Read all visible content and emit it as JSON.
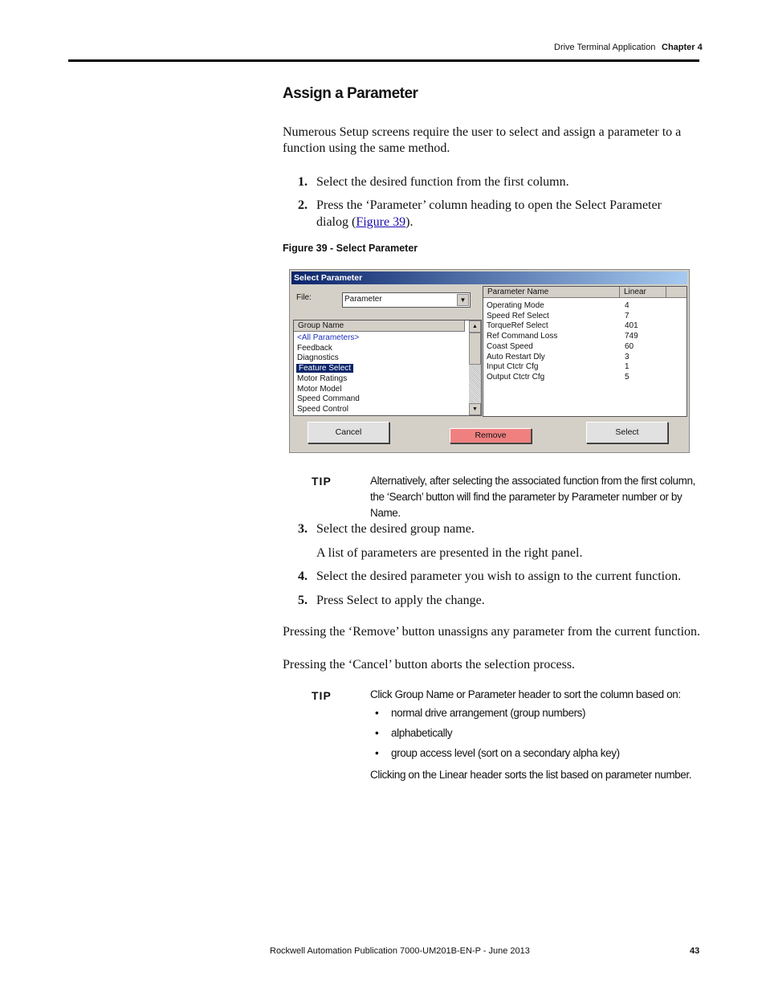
{
  "header": {
    "section": "Drive Terminal Application",
    "chapter": "Chapter 4"
  },
  "heading": "Assign a Parameter",
  "intro": "Numerous Setup screens require the user to select and assign a parameter to a function using the same method.",
  "steps": [
    {
      "num": "1.",
      "text": "Select the desired function from the first column."
    },
    {
      "num": "2.",
      "text_before": "Press the ‘Parameter’ column heading to open the Select Parameter dialog (",
      "link": "Figure 39",
      "text_after": ")."
    },
    {
      "num": "3.",
      "text": "Select the desired group name."
    },
    {
      "num": "4.",
      "text": "Select the desired parameter you wish to assign to the current function."
    },
    {
      "num": "5.",
      "text": "Press Select to apply the change."
    }
  ],
  "step3_note": "A list of parameters are presented in the right panel.",
  "figure_caption": "Figure 39 - Select Parameter",
  "dialog": {
    "title": "Select Parameter",
    "file_label": "File:",
    "file_value": "Parameter",
    "group_header": "Group Name",
    "groups": [
      "<All Parameters>",
      "Feedback",
      "Diagnostics",
      "Feature Select",
      "Motor Ratings",
      "Motor Model",
      "Speed Command",
      "Speed Control"
    ],
    "selected_group": "Feature Select",
    "param_header": "Parameter Name",
    "linear_header": "Linear",
    "params": [
      {
        "name": "Operating Mode",
        "linear": "4"
      },
      {
        "name": "Speed Ref Select",
        "linear": "7"
      },
      {
        "name": "TorqueRef Select",
        "linear": "401"
      },
      {
        "name": "Ref Command Loss",
        "linear": "749"
      },
      {
        "name": "Coast Speed",
        "linear": "60"
      },
      {
        "name": "Auto Restart Dly",
        "linear": "3"
      },
      {
        "name": "Input Ctctr Cfg",
        "linear": "1"
      },
      {
        "name": "Output Ctctr Cfg",
        "linear": "5"
      }
    ],
    "cancel": "Cancel",
    "remove": "Remove",
    "select": "Select",
    "colors": {
      "title_start": "#0a246a",
      "remove": "#f08080",
      "face": "#d4d0c8"
    }
  },
  "tip_label": "TIP",
  "tip1": "Alternatively, after selecting the associated function from the first column, the ‘Search’ button will find the parameter by Parameter number or by Name.",
  "para_remove": "Pressing the ‘Remove’ button unassigns any parameter from the current function.",
  "para_cancel": "Pressing the ‘Cancel’ button aborts the selection process.",
  "tip2": {
    "intro": "Click Group Name or Parameter header to sort the column based on:",
    "bullets": [
      "normal drive arrangement (group numbers)",
      "alphabetically",
      "group access level (sort on a secondary alpha key)"
    ],
    "outro": "Clicking on the Linear header sorts the list based on parameter number."
  },
  "footer": {
    "publication": "Rockwell Automation Publication 7000-UM201B-EN-P - June 2013",
    "page": "43"
  }
}
